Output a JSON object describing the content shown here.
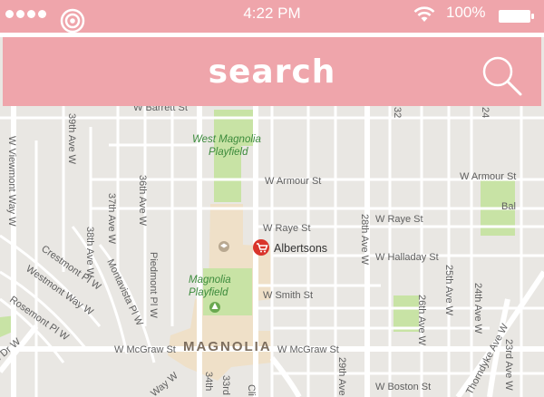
{
  "status_bar": {
    "time": "4:22 PM",
    "battery": "100%",
    "icons": [
      "signal-dots-icon",
      "carrier-ring-icon",
      "wifi-icon",
      "battery-icon"
    ]
  },
  "search": {
    "label": "search",
    "icon": "magnifier-icon"
  },
  "colors": {
    "accent": "#efa5ab",
    "map_bg": "#e9e7e3",
    "road": "#ffffff",
    "park": "#c8e3a5",
    "district": "#efe0c8",
    "pin": "#d9342b"
  },
  "map": {
    "district": "MAGNOLIA",
    "parks": [
      "West Magnolia Playfield",
      "Magnolia Playfield"
    ],
    "poi": {
      "name": "Albertsons",
      "icon": "shopping-cart-icon"
    },
    "streets": {
      "barrett": "W Barrett St",
      "armour": "W Armour St",
      "armour_east": "W Armour St",
      "raye": "W Raye St",
      "raye_east": "W Raye St",
      "halladay": "W Halladay St",
      "smith": "W Smith St",
      "mcgraw_west": "W McGraw St",
      "mcgraw_east": "W McGraw St",
      "boston": "W Boston St",
      "viewmont": "W Viewmont Way W",
      "ave39": "39th Ave W",
      "ave38": "38th Ave W",
      "ave37": "37th Ave W",
      "ave36": "36th Ave W",
      "crestmont": "Crestmont Pl W",
      "westmont": "Westmont Way W",
      "rosemont": "Rosemont Pl W",
      "montavista": "Montavista Pl W",
      "piedmont": "Piedmont Pl W",
      "ave28": "28th Ave W",
      "ave26": "26th Ave W",
      "ave25": "25th Ave W",
      "ave24": "24th Ave W",
      "ave23": "23rd Ave W",
      "ave29": "29th Ave W",
      "thorndyke": "Thorndyke Ave W",
      "ave34": "34th",
      "ave33": "33rd",
      "clise": "Cli",
      "way": "Way W",
      "dr": "e Dr W",
      "bal": "Bal",
      "ave24_top": "24",
      "ave32_top": "32"
    }
  }
}
